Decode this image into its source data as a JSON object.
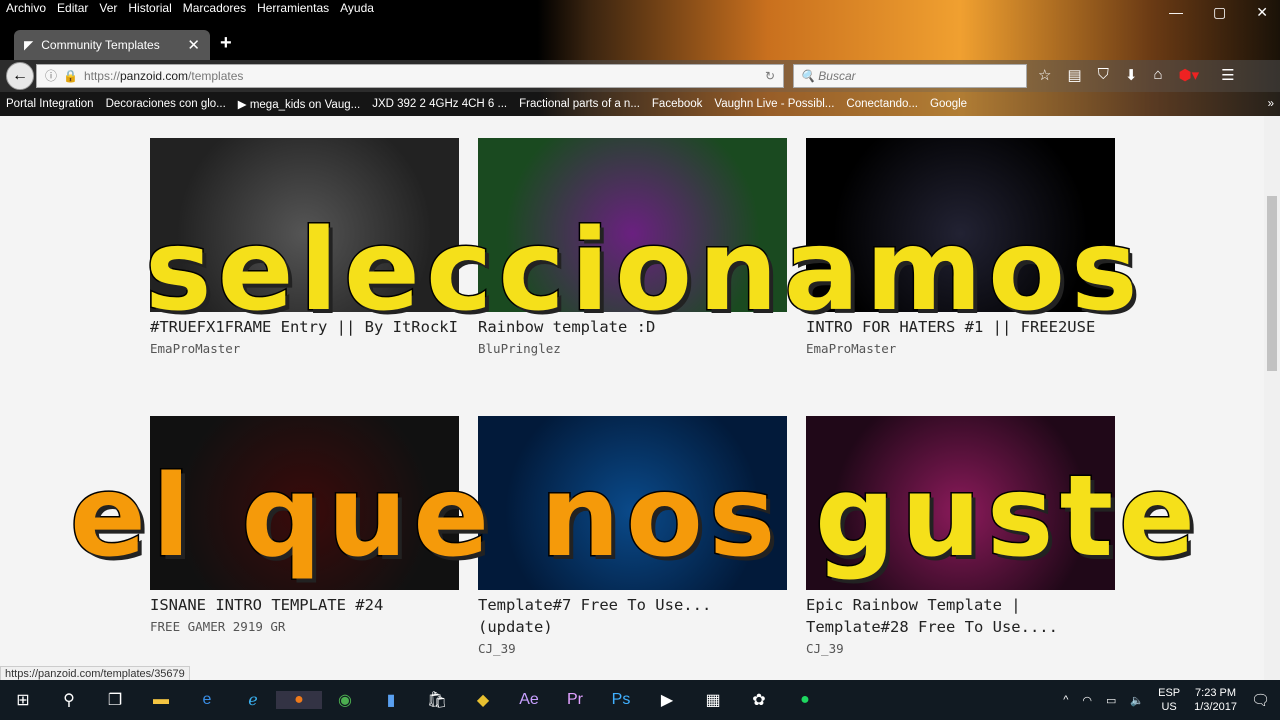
{
  "menu": [
    "Archivo",
    "Editar",
    "Ver",
    "Historial",
    "Marcadores",
    "Herramientas",
    "Ayuda"
  ],
  "tab": {
    "title": "Community Templates"
  },
  "url": {
    "prefix": "https://",
    "domain": "panzoid.com",
    "path": "/templates"
  },
  "search_placeholder": "Buscar",
  "bookmarks": [
    "Portal Integration",
    "Decoraciones con glo...",
    "▶ mega_kids on Vaug...",
    "JXD 392 2 4GHz 4CH 6 ...",
    "Fractional parts of a n...",
    "Facebook",
    "Vaughn Live - Possibl...",
    "Conectando...",
    "Google"
  ],
  "cards": [
    {
      "title": "#TRUEFX1FRAME Entry || By ItRockI",
      "author": "EmaProMaster",
      "colors": [
        "#222",
        "#555"
      ]
    },
    {
      "title": "Rainbow template :D",
      "author": "BluPringlez",
      "colors": [
        "#1a4a20",
        "#6a2080"
      ]
    },
    {
      "title": "INTRO FOR HATERS #1 || FREE2USE",
      "author": "EmaProMaster",
      "colors": [
        "#000",
        "#223"
      ]
    },
    {
      "title": "ISNANE INTRO TEMPLATE #24",
      "author": "FREE GAMER 2919 GR",
      "colors": [
        "#111",
        "#3a0a0a"
      ]
    },
    {
      "title": "Template#7 Free To Use... (update)",
      "author": "CJ_39",
      "colors": [
        "#021a3a",
        "#0a4a8a"
      ]
    },
    {
      "title": "Epic Rainbow Template | Template#28 Free To Use....",
      "author": "CJ_39",
      "colors": [
        "#200818",
        "#8a1a5a"
      ]
    }
  ],
  "overlay": {
    "line1": "seleccionamos",
    "line2a": "el que nos",
    "line2b": "guste"
  },
  "status_url": "https://panzoid.com/templates/35679",
  "tray": {
    "lang": "ESP",
    "layout": "US",
    "time": "7:23 PM",
    "date": "1/3/2017"
  }
}
